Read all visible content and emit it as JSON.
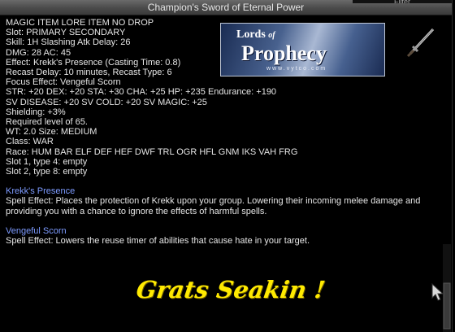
{
  "window": {
    "title": "Champion's Sword of Eternal Power"
  },
  "item_lines": [
    "MAGIC ITEM LORE ITEM NO DROP",
    "Slot: PRIMARY SECONDARY",
    "Skill: 1H Slashing Atk Delay: 26",
    "DMG: 28 AC: 45",
    "Effect: Krekk's Presence (Casting Time: 0.8)",
    "Recast Delay: 10 minutes, Recast Type: 6",
    "Focus Effect: Vengeful Scorn",
    "STR: +20 DEX: +20 STA: +30 CHA: +25 HP: +235 Endurance: +190",
    "SV DISEASE: +20 SV COLD: +20 SV MAGIC: +25",
    "Shielding: +3%",
    "Required level of 65.",
    "WT: 2.0 Size: MEDIUM",
    "Class: WAR",
    "Race: HUM BAR ELF DEF HEF DWF TRL OGR HFL GNM IKS VAH FRG",
    "Slot 1, type 4: empty",
    "Slot 2, type 8: empty"
  ],
  "spells": [
    {
      "name": "Krekk's Presence",
      "description": "Spell Effect: Places the protection of Krekk upon your group. Lowering their incoming melee damage and providing you with a chance to ignore the effects of harmful spells."
    },
    {
      "name": "Vengeful Scorn",
      "description": "Spell Effect: Lowers the reuse timer of abilities that cause hate in your target."
    }
  ],
  "logo": {
    "line1": "Lords",
    "line1_suffix": "of",
    "line2": "Prophecy",
    "url": "www.vytco.com"
  },
  "caption": "Grats Seakin !",
  "colors": {
    "spell_name": "#7d9bff",
    "caption": "#ffea00",
    "text": "#e6e6e6"
  },
  "icons": {
    "item": "sword-icon",
    "pointer": "cursor-icon"
  },
  "top_right_fragment": "Filter"
}
